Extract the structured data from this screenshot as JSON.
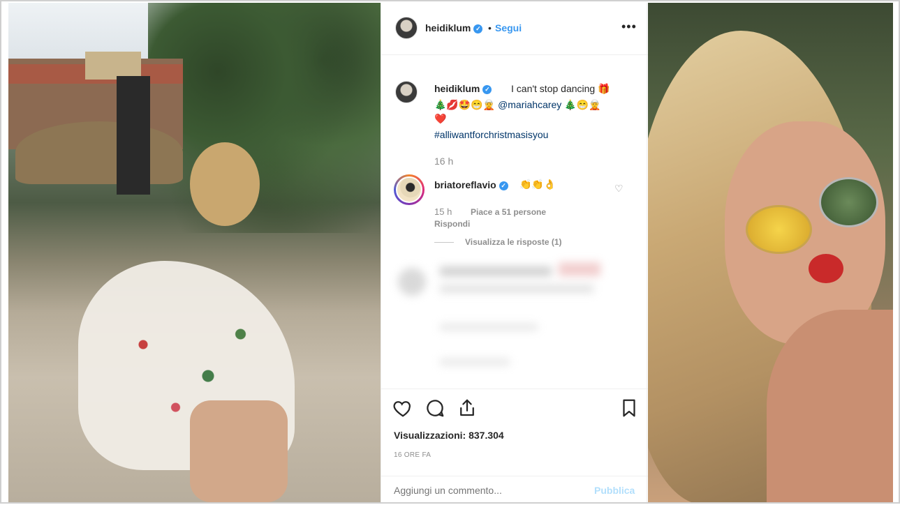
{
  "post": {
    "header": {
      "username": "heidiklum",
      "dot": "•",
      "follow_label": "Segui",
      "more_label": "•••"
    },
    "caption": {
      "username": "heidiklum",
      "text": "I can't stop dancing 🎁",
      "line2_emojis": "🎄💋🤩😁🧝",
      "mention": "@mariahcarey",
      "line2_tail": "🎄😁🧝",
      "line3": "❤️",
      "hashtag": "#alliwantforchristmasisyou",
      "time": "16 h"
    },
    "comment": {
      "username": "briatoreflavio",
      "text": "👏👏👌",
      "time": "15 h",
      "likes": "Piace a 51 persone",
      "reply": "Rispondi",
      "view_replies": "Visualizza le risposte (1)"
    },
    "views_label": "Visualizzazioni: 837.304",
    "date": "16 ORE FA",
    "add_comment_placeholder": "Aggiungi un commento...",
    "publish_label": "Pubblica"
  },
  "icons": {
    "like": "heart-icon",
    "comment": "comment-icon",
    "share": "share-icon",
    "save": "bookmark-icon",
    "verified": "verified-badge-icon",
    "comment_like": "heart-small-icon"
  },
  "colors": {
    "link_blue": "#3897f0",
    "hashtag_blue": "#003569",
    "text": "#262626",
    "muted": "#8e8e8e"
  }
}
